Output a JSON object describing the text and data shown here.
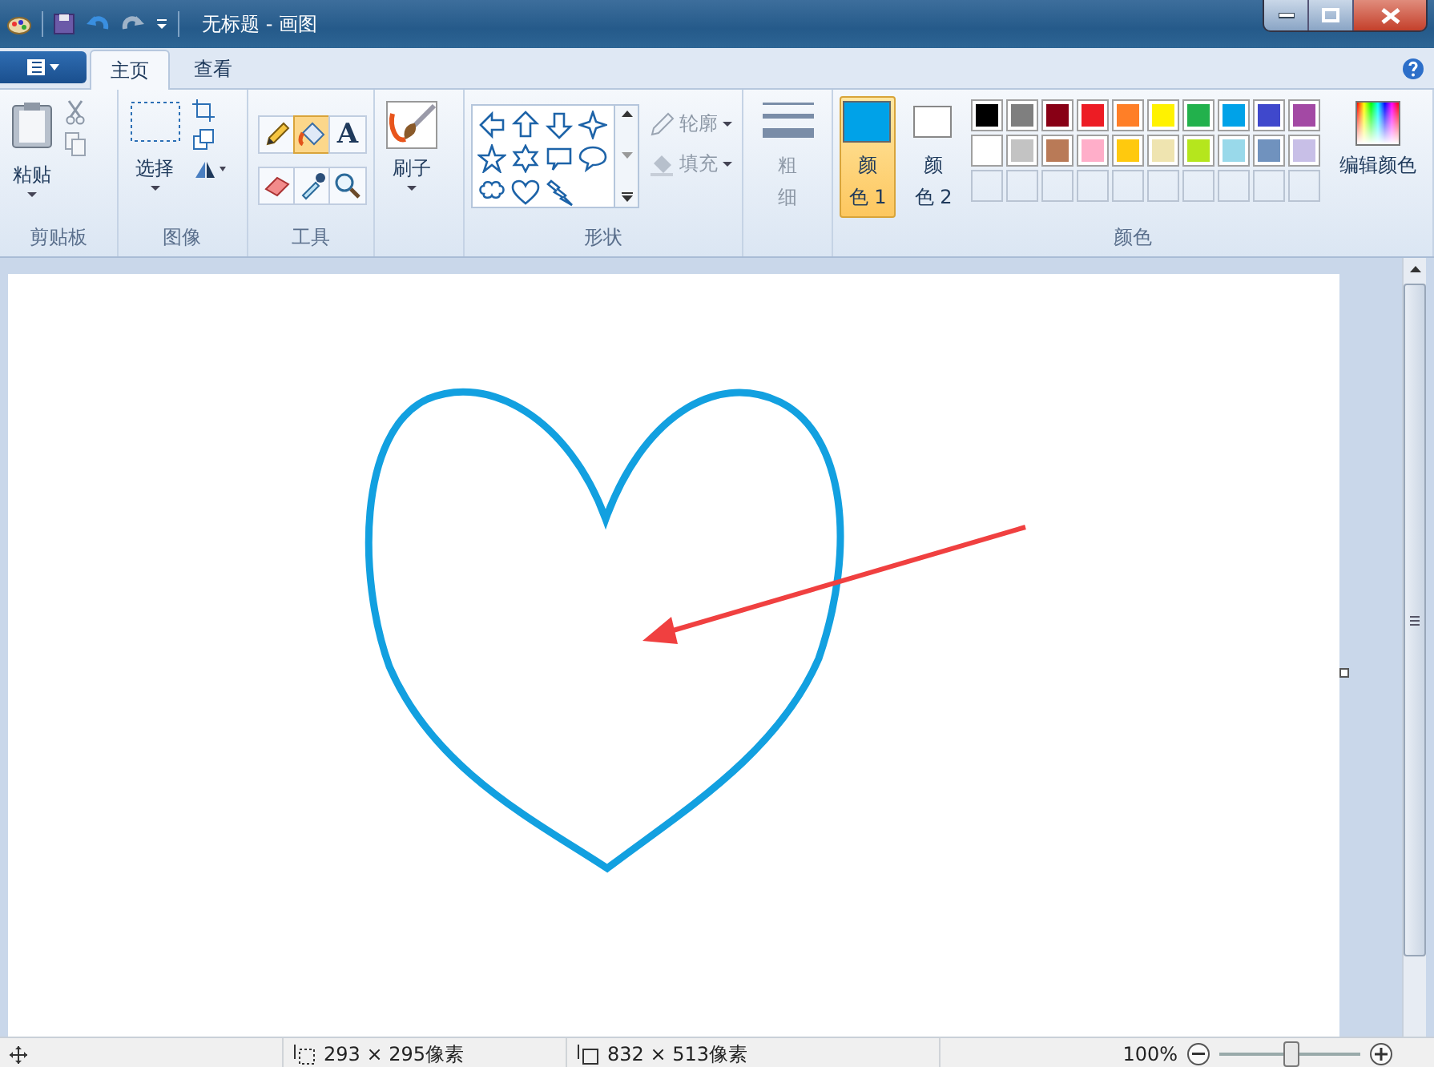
{
  "window": {
    "title": "无标题 - 画图"
  },
  "tabs": [
    {
      "label": "主页",
      "selected": true
    },
    {
      "label": "查看",
      "selected": false
    }
  ],
  "clipboard": {
    "paste": "粘贴",
    "group": "剪贴板"
  },
  "image": {
    "select": "选择",
    "group": "图像"
  },
  "tools": {
    "group": "工具",
    "items": [
      {
        "kind": "pencil",
        "selected": false
      },
      {
        "kind": "fill",
        "selected": true
      },
      {
        "kind": "text",
        "glyph": "A",
        "selected": false
      },
      {
        "kind": "eraser",
        "selected": false
      },
      {
        "kind": "picker",
        "selected": false
      },
      {
        "kind": "magnifier",
        "selected": false
      }
    ]
  },
  "brush": {
    "label": "刷子"
  },
  "shapes": {
    "group": "形状",
    "outline": {
      "label": "轮廓",
      "disabled": true
    },
    "fill": {
      "label": "填充",
      "disabled": true
    }
  },
  "size": {
    "label_lines": [
      "粗",
      "细"
    ],
    "disabled": true
  },
  "colors": {
    "group": "颜色",
    "edit": "编辑颜色",
    "color1": {
      "label_lines": [
        "颜",
        "色 1"
      ],
      "color": "#00a2e8",
      "selected": true
    },
    "color2": {
      "label_lines": [
        "颜",
        "色 2"
      ],
      "color": "#ffffff",
      "selected": false
    },
    "palette": [
      {
        "color": "#000000"
      },
      {
        "color": "#7f7f7f"
      },
      {
        "color": "#880015"
      },
      {
        "color": "#ed1c24"
      },
      {
        "color": "#ff7f27"
      },
      {
        "color": "#fff200"
      },
      {
        "color": "#22b14c"
      },
      {
        "color": "#00a2e8"
      },
      {
        "color": "#3f48cc"
      },
      {
        "color": "#a349a4"
      },
      {
        "color": "#ffffff"
      },
      {
        "color": "#c3c3c3"
      },
      {
        "color": "#b97a57"
      },
      {
        "color": "#ffaec9"
      },
      {
        "color": "#ffc90e"
      },
      {
        "color": "#efe4b0"
      },
      {
        "color": "#b5e61d"
      },
      {
        "color": "#99d9ea"
      },
      {
        "color": "#7092be"
      },
      {
        "color": "#c8bfe7"
      }
    ]
  },
  "status_bar": {
    "selection_size": "293 × 295像素",
    "canvas_size": "832 × 513像素",
    "zoom": "100%",
    "zoom_level": {
      "level": 0.5
    }
  }
}
